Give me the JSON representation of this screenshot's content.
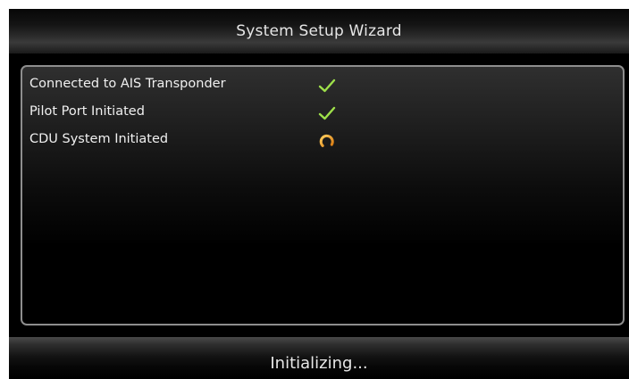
{
  "window": {
    "title": "System Setup Wizard"
  },
  "status_items": [
    {
      "label": "Connected to AIS Transponder",
      "state": "complete",
      "icon": "checkmark-icon"
    },
    {
      "label": "Pilot Port Initiated",
      "state": "complete",
      "icon": "checkmark-icon"
    },
    {
      "label": "CDU System Initiated",
      "state": "in-progress",
      "icon": "loading-spinner-icon"
    }
  ],
  "footer": {
    "status_text": "Initializing..."
  },
  "colors": {
    "complete": "#9ee04a",
    "in_progress": "#f0a020",
    "panel_border": "#8e8e8e"
  }
}
